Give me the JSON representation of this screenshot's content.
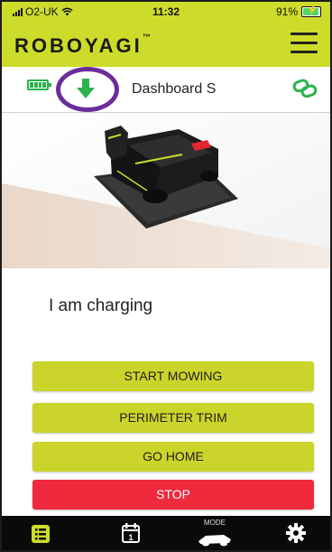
{
  "status_bar": {
    "carrier": "O2-UK",
    "time": "11:32",
    "battery": "91%"
  },
  "header": {
    "logo": "ROBOYAGI",
    "trademark": "™"
  },
  "dashboard": {
    "title": "Dashboard S",
    "battery_level": 1.0,
    "icons": {
      "battery": "battery-full-icon",
      "arrow": "arrow-down-icon",
      "link": "link-icon"
    }
  },
  "main": {
    "status_text": "I am charging"
  },
  "actions": {
    "start_mowing": "START MOWING",
    "perimeter_trim": "PERIMETER TRIM",
    "go_home": "GO HOME",
    "stop": "STOP"
  },
  "tabbar": {
    "mode_label": "MODE",
    "icons": [
      "list-icon",
      "calendar-icon",
      "mower-mode-icon",
      "gear-icon"
    ]
  },
  "colors": {
    "brand": "#cddc2a",
    "button": "#cbd42a",
    "stop": "#ee2a3c",
    "highlight_circle": "#6b2d9a",
    "status_green": "#2bb24c"
  }
}
